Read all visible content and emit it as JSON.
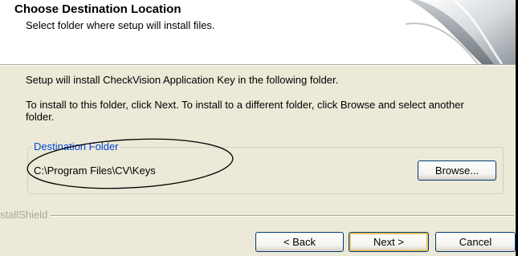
{
  "header": {
    "title": "Choose Destination Location",
    "subtitle": "Select folder where setup will install files."
  },
  "body": {
    "install_info": "Setup will install CheckVision Application Key in the following folder.",
    "instructions": "To install to this folder, click Next. To install to a different folder, click Browse and select another folder."
  },
  "destination": {
    "legend": "Destination Folder",
    "path": "C:\\Program Files\\CV\\Keys",
    "browse_label": "Browse..."
  },
  "footer": {
    "brand": "stallShield",
    "back_label": "< Back",
    "next_label": "Next >",
    "cancel_label": "Cancel"
  },
  "colors": {
    "dialog_bg": "#ece9d8",
    "legend_text": "#0046d5",
    "button_border": "#003c74",
    "default_button_focus": "#e5c365"
  },
  "icons": {
    "header_graphic": "installer-swoosh-graphic",
    "annotation": "hand-drawn-ellipse"
  }
}
